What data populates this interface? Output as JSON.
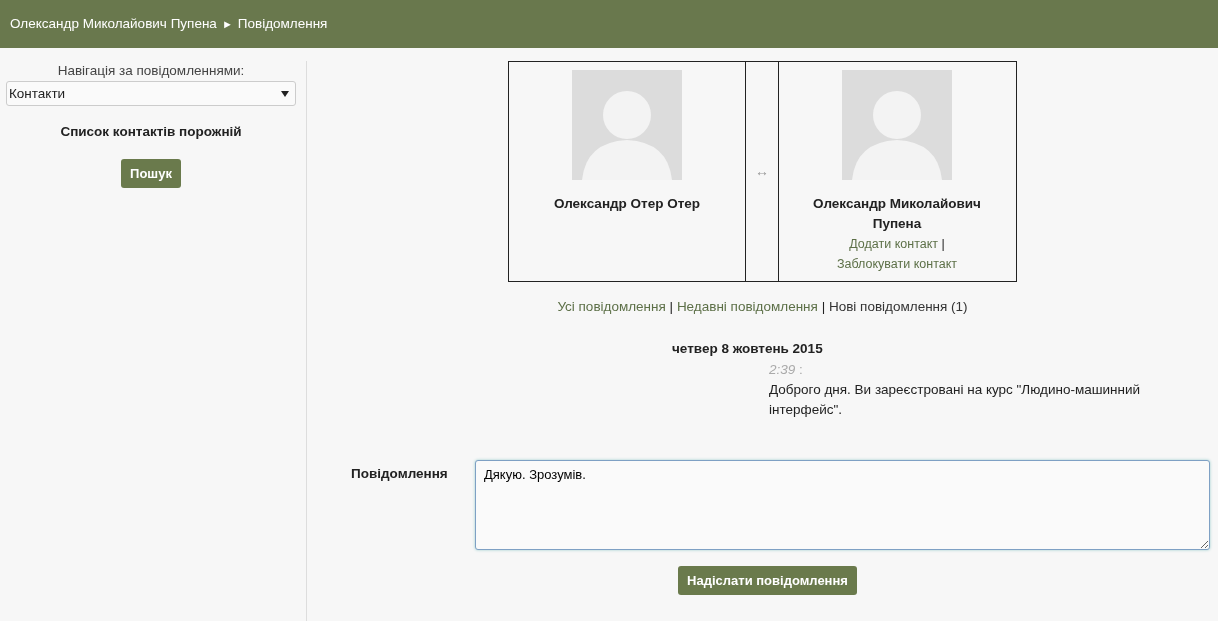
{
  "breadcrumb": {
    "items": [
      {
        "label": "Олександр Миколайович Пупена"
      },
      {
        "label": "Повідомлення"
      }
    ],
    "separator": "►"
  },
  "sidebar": {
    "nav_label": "Навігація за повідомленнями:",
    "select": {
      "value": "Контакти"
    },
    "empty_text": "Список контактів порожній",
    "search_button": "Пошук"
  },
  "participants": [
    {
      "name": "Олександр Отер Отер"
    },
    {
      "name": "Олександр Миколайович Пупена",
      "actions": [
        "Додати контакт",
        "Заблокувати контакт"
      ]
    }
  ],
  "participants_arrow": "↔",
  "action_separator": "|",
  "history_tabs": [
    {
      "label": "Усі повідомлення",
      "selected": false
    },
    {
      "label": "Недавні повідомлення",
      "selected": false
    },
    {
      "label": "Нові повідомлення (1)",
      "selected": true
    }
  ],
  "history_separator": "|",
  "date": "четвер 8 жовтень 2015",
  "messages": [
    {
      "time": "2:39",
      "time_suffix": ":",
      "text": "Доброго дня. Ви зареєстровані на курс \"Людино-машинний інтерфейс\"."
    }
  ],
  "form": {
    "label": "Повідомлення",
    "value": "Дякую. Зрозумів.",
    "submit": "Надіслати повідомлення"
  }
}
